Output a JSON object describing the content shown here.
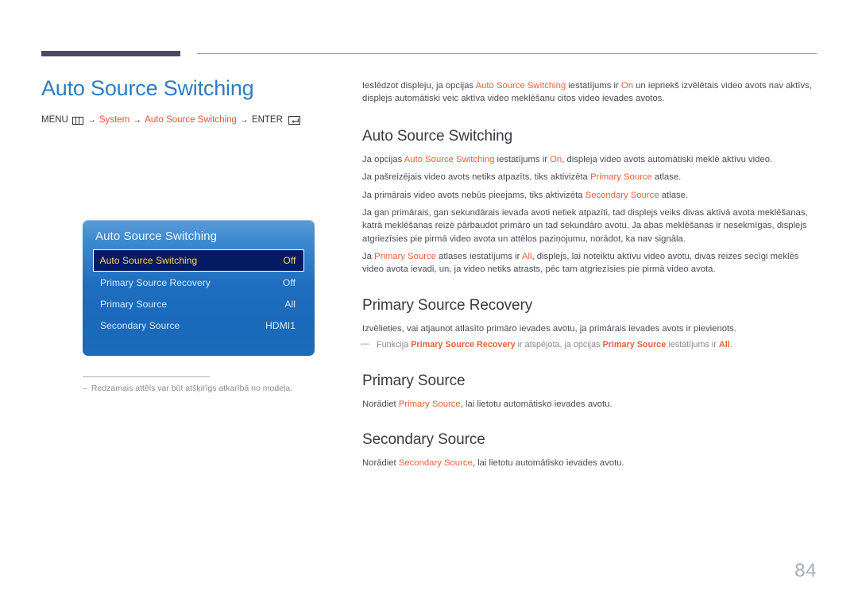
{
  "header": {
    "rule_thick": "",
    "rule_thin": ""
  },
  "left": {
    "title": "Auto Source Switching",
    "breadcrumb": {
      "menu_label": "MENU",
      "menu_icon": "menu-grid-icon",
      "arrow": "→",
      "item1": "System",
      "item2": "Auto Source Switching",
      "enter_label": "ENTER",
      "enter_icon": "enter-key-icon"
    },
    "osd": {
      "title": "Auto Source Switching",
      "rows": [
        {
          "label": "Auto Source Switching",
          "value": "Off",
          "selected": true
        },
        {
          "label": "Primary Source Recovery",
          "value": "Off",
          "selected": false
        },
        {
          "label": "Primary Source",
          "value": "All",
          "selected": false
        },
        {
          "label": "Secondary Source",
          "value": "HDMI1",
          "selected": false
        }
      ]
    },
    "footnote": {
      "dash": "–",
      "text": "Redzamais attēls var būt atšķirīgs atkarībā no modeļa."
    }
  },
  "right": {
    "intro": {
      "p1_a": "Ieslēdzot displeju, ja opcijas ",
      "p1_t1": "Auto Source Switching",
      "p1_b": " iestatījums ir ",
      "p1_t2": "On",
      "p1_c": " un iepriekš izvēlētais video avots nav aktīvs, displejs automātiski veic aktīva video meklēšanu citos video ievades avotos."
    },
    "sections": [
      {
        "heading": "Auto Source Switching",
        "paras": [
          {
            "a": "Ja opcijas ",
            "t1": "Auto Source Switching",
            "b": " iestatījums ir ",
            "t2": "On",
            "c": ", displeja video avots automātiski meklē aktīvu video."
          },
          {
            "a": "Ja pašreizējais video avots netiks atpazīts, tiks aktivizēta ",
            "t1": "Primary Source",
            "b": " atlase.",
            "t2": "",
            "c": ""
          },
          {
            "a": "Ja primārais video avots nebūs pieejams, tiks aktivizēta ",
            "t1": "Secondary Source",
            "b": " atlase.",
            "t2": "",
            "c": ""
          },
          {
            "a": "Ja gan primārais, gan sekundārais ievada avoti netiek atpazīti, tad displejs veiks divas aktīvā avota meklēšanas, katrā meklēšanas reizē pārbaudot primāro un tad sekundāro avotu. Ja abas meklēšanas ir nesekmīgas, displejs atgriezīsies pie pirmā video avota un attēlos paziņojumu, norādot, ka nav signāla.",
            "t1": "",
            "b": "",
            "t2": "",
            "c": ""
          },
          {
            "a": "Ja ",
            "t1": "Primary Source",
            "b": " atlases iestatījums ir ",
            "t2": "All",
            "c": ", displejs, lai noteiktu aktīvu video avotu, divas reizes secīgi meklēs video avota ievadi, un, ja video netiks atrasts, pēc tam atgriezīsies pie pirmā video avota."
          }
        ]
      },
      {
        "heading": "Primary Source Recovery",
        "paras": [
          {
            "a": "Izvēlieties, vai atjaunot atlasīto primāro ievades avotu, ja primārais ievades avots ir pievienots.",
            "t1": "",
            "b": "",
            "t2": "",
            "c": ""
          }
        ],
        "note": {
          "dash": "—",
          "a": "Funkcija ",
          "t1": "Primary Source Recovery",
          "b": " ir atspējota, ja opcijas ",
          "t2": "Primary Source",
          "c": " iestatījums ir ",
          "t3": "All",
          "d": "."
        }
      },
      {
        "heading": "Primary Source",
        "paras": [
          {
            "a": "Norādiet ",
            "t1": "Primary Source",
            "b": ", lai lietotu automātisko ievades avotu.",
            "t2": "",
            "c": ""
          }
        ]
      },
      {
        "heading": "Secondary Source",
        "paras": [
          {
            "a": "Norādiet ",
            "t1": "Secondary Source",
            "b": ", lai lietotu automātisko ievades avotu.",
            "t2": "",
            "c": ""
          }
        ]
      }
    ]
  },
  "footer": {
    "page_number": "84"
  },
  "colors": {
    "title_blue": "#2b7cc4",
    "accent_orange": "#e8613c",
    "rule_dark": "#474a61",
    "osd_blue": "#1f6fc0",
    "osd_selected_bg": "#041b63",
    "osd_selected_text": "#ffd84d",
    "page_number": "#a8adb8"
  }
}
